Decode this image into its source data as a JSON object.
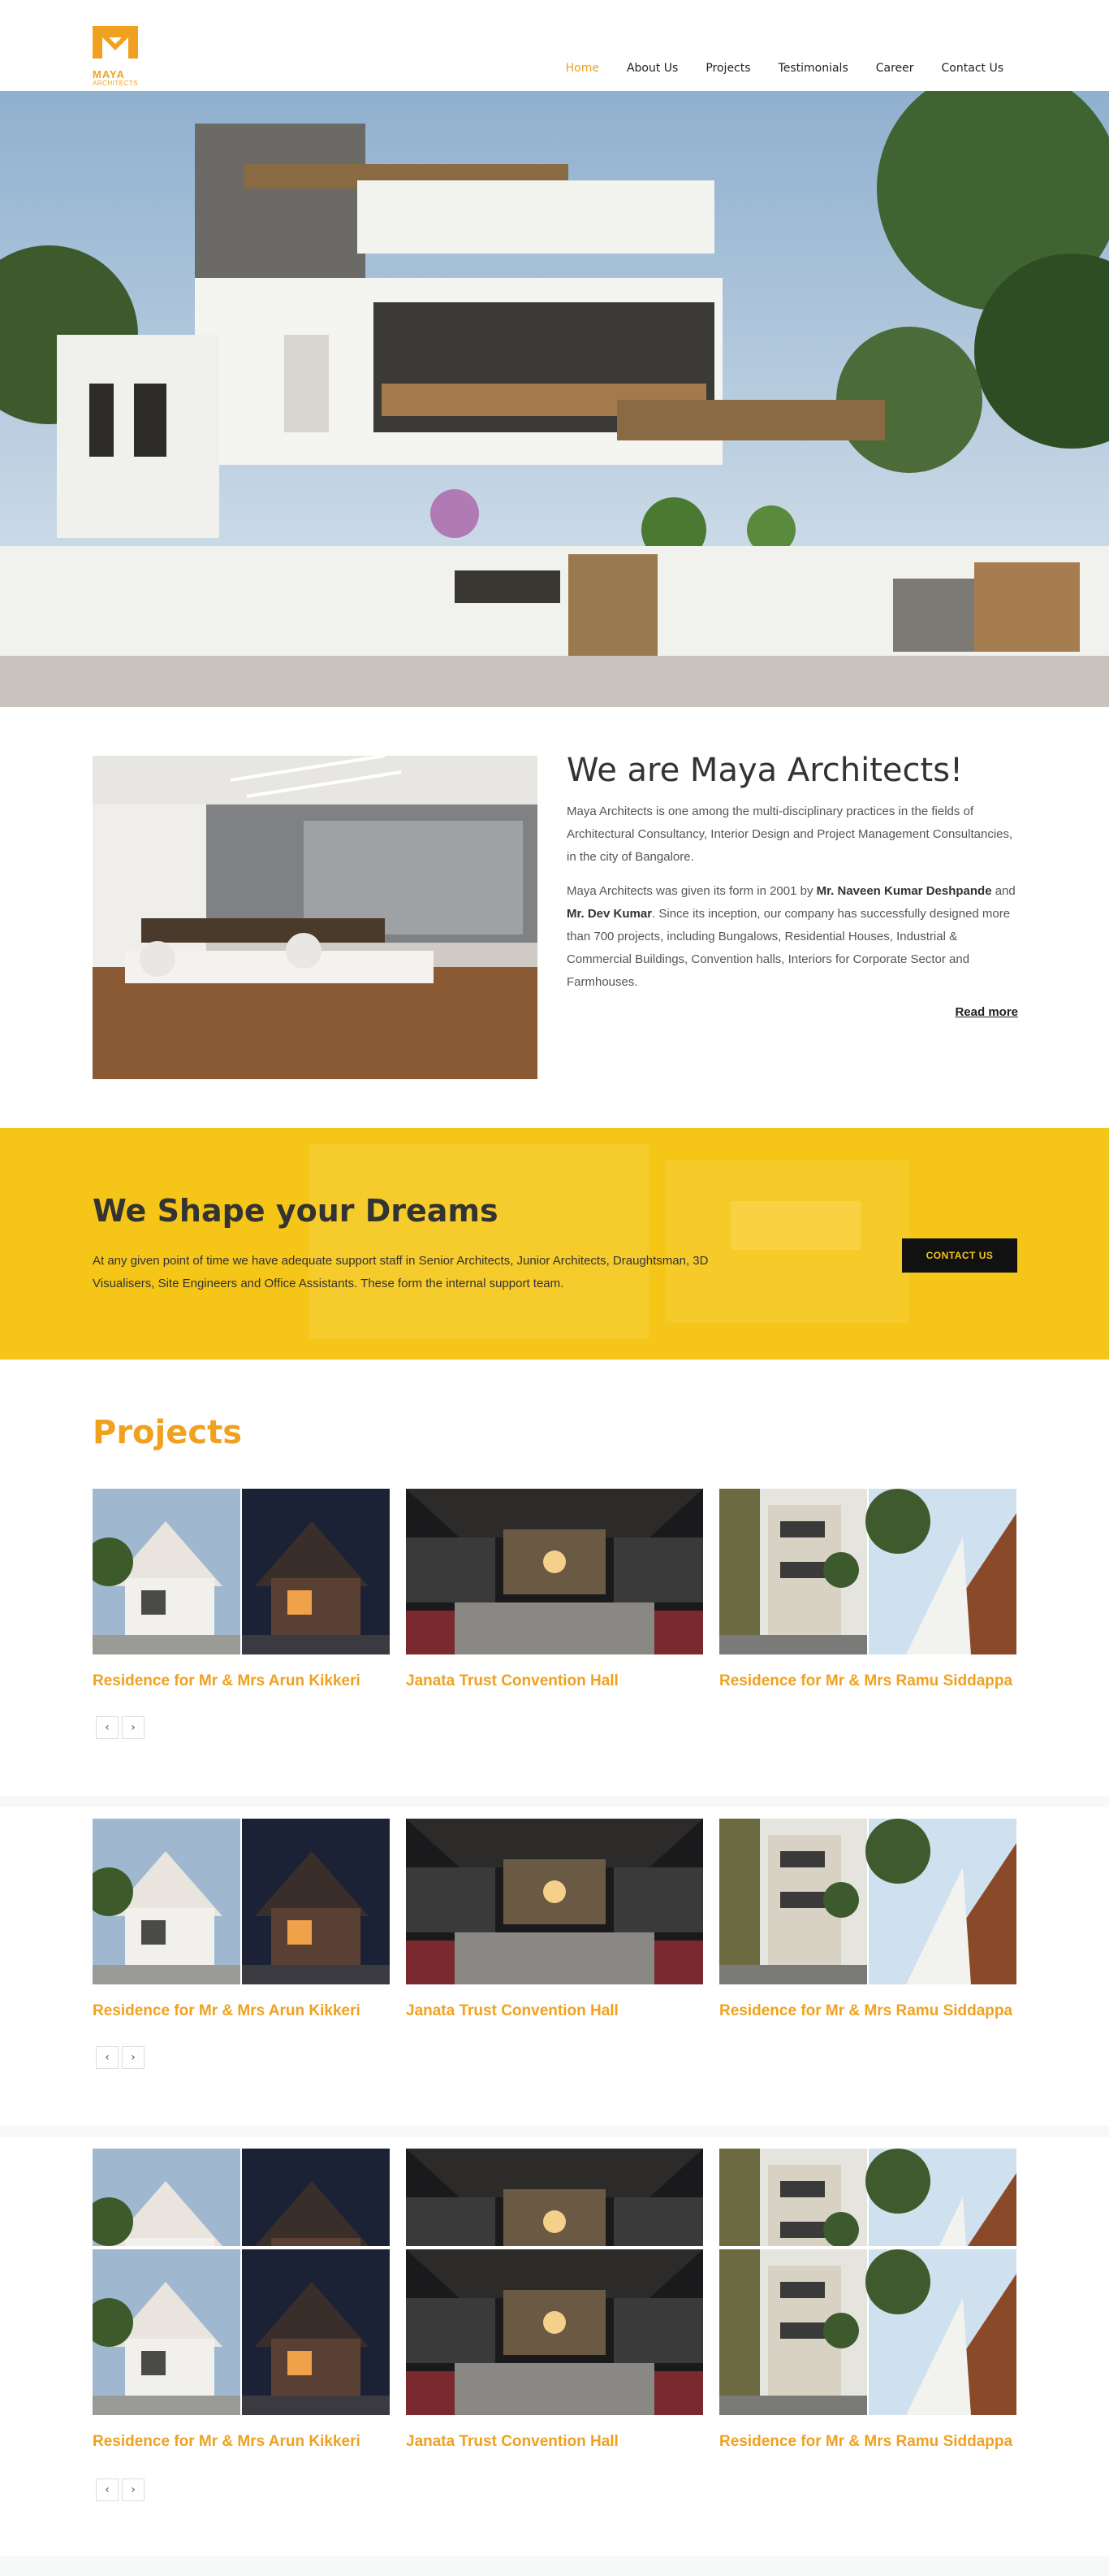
{
  "brand": {
    "name": "MAYA",
    "tagline": "ARCHITECTS"
  },
  "nav": {
    "items": [
      {
        "label": "Home",
        "active": true
      },
      {
        "label": "About Us",
        "active": false
      },
      {
        "label": "Projects",
        "active": false
      },
      {
        "label": "Testimonials",
        "active": false
      },
      {
        "label": "Career",
        "active": false
      },
      {
        "label": "Contact Us",
        "active": false
      }
    ]
  },
  "about": {
    "title": "We are Maya Architects!",
    "para1": "Maya Architects is one among the multi-disciplinary practices in the fields of Architectural Consultancy, Interior Design and Project Management Consultancies, in the city of Bangalore.",
    "para2_prefix": "Maya Architects was given its form in 2001 by ",
    "founder1": "Mr. Naveen Kumar Deshpande",
    "para2_mid": " and ",
    "founder2": "Mr. Dev Kumar",
    "para2_suffix": ". Since its inception, our company has successfully designed more than 700 projects, including Bungalows, Residential Houses, Industrial & Commercial Buildings, Convention halls, Interiors for Corporate Sector and Farmhouses.",
    "read_more": "Read more"
  },
  "band": {
    "title": "We Shape your Dreams",
    "text": "At any given point of time we have adequate support staff in Senior Architects, Junior Architects, Draughtsman, 3D Visualisers, Site Engineers and Office Assistants. These form the internal support team.",
    "button": "CONTACT US"
  },
  "projects": {
    "heading": "Projects",
    "cards": [
      {
        "title": "Residence for Mr & Mrs Arun Kikkeri"
      },
      {
        "title": "Janata Trust Convention Hall"
      },
      {
        "title": "Residence for Mr & Mrs Ramu Siddappa"
      }
    ],
    "prev": "‹",
    "next": "›"
  },
  "colors": {
    "accent": "#f0a11f",
    "band": "#f5c518",
    "dark": "#111111"
  }
}
